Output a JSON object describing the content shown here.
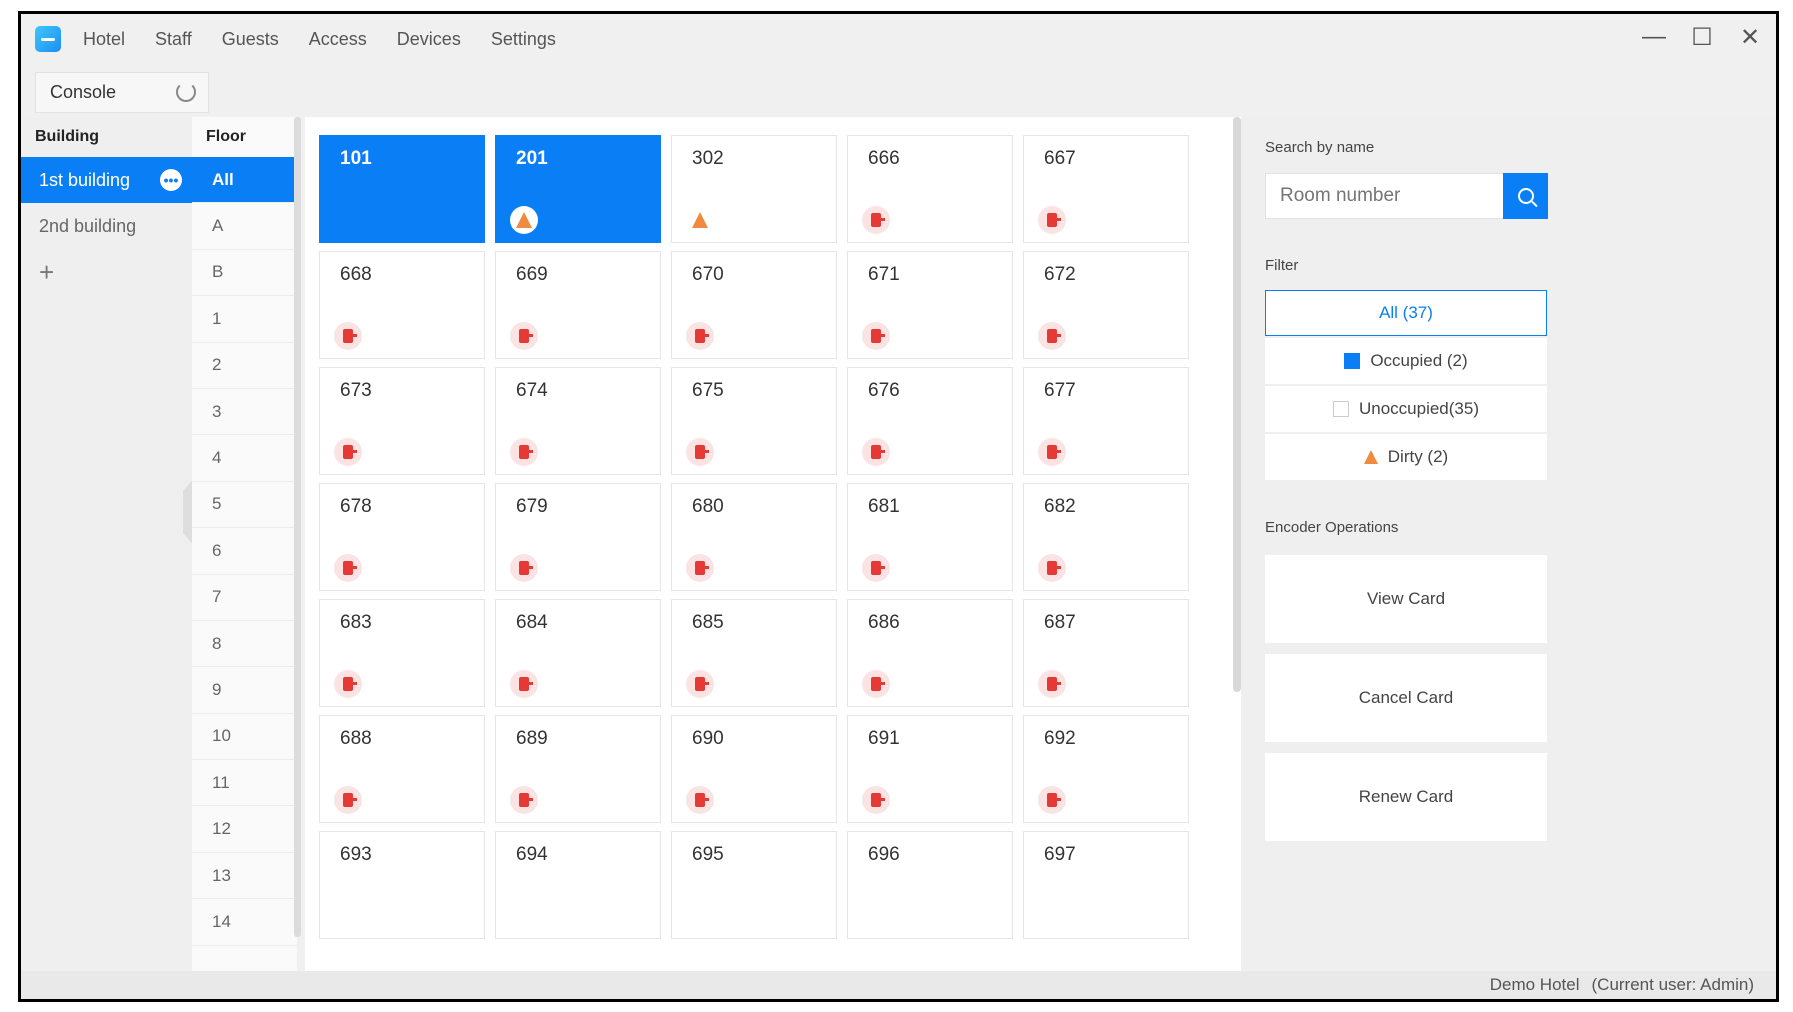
{
  "menu": [
    "Hotel",
    "Staff",
    "Guests",
    "Access",
    "Devices",
    "Settings"
  ],
  "window_controls": {
    "minimize": "—",
    "maximize": "☐",
    "close": "✕"
  },
  "tab": {
    "label": "Console"
  },
  "building": {
    "header": "Building",
    "items": [
      {
        "label": "1st building",
        "active": true
      },
      {
        "label": "2nd building",
        "active": false
      }
    ],
    "add_label": "+"
  },
  "floor": {
    "header": "Floor",
    "items": [
      "All",
      "A",
      "B",
      "1",
      "2",
      "3",
      "4",
      "5",
      "6",
      "7",
      "8",
      "9",
      "10",
      "11",
      "12",
      "13",
      "14"
    ]
  },
  "rooms": [
    {
      "number": "101",
      "status": "occupied",
      "icon": ""
    },
    {
      "number": "201",
      "status": "occupied",
      "icon": "dirty"
    },
    {
      "number": "302",
      "status": "unoccupied",
      "icon": "dirty"
    },
    {
      "number": "666",
      "status": "unoccupied",
      "icon": "lock"
    },
    {
      "number": "667",
      "status": "unoccupied",
      "icon": "lock"
    },
    {
      "number": "668",
      "status": "unoccupied",
      "icon": "lock"
    },
    {
      "number": "669",
      "status": "unoccupied",
      "icon": "lock"
    },
    {
      "number": "670",
      "status": "unoccupied",
      "icon": "lock"
    },
    {
      "number": "671",
      "status": "unoccupied",
      "icon": "lock"
    },
    {
      "number": "672",
      "status": "unoccupied",
      "icon": "lock"
    },
    {
      "number": "673",
      "status": "unoccupied",
      "icon": "lock"
    },
    {
      "number": "674",
      "status": "unoccupied",
      "icon": "lock"
    },
    {
      "number": "675",
      "status": "unoccupied",
      "icon": "lock"
    },
    {
      "number": "676",
      "status": "unoccupied",
      "icon": "lock"
    },
    {
      "number": "677",
      "status": "unoccupied",
      "icon": "lock"
    },
    {
      "number": "678",
      "status": "unoccupied",
      "icon": "lock"
    },
    {
      "number": "679",
      "status": "unoccupied",
      "icon": "lock"
    },
    {
      "number": "680",
      "status": "unoccupied",
      "icon": "lock"
    },
    {
      "number": "681",
      "status": "unoccupied",
      "icon": "lock"
    },
    {
      "number": "682",
      "status": "unoccupied",
      "icon": "lock"
    },
    {
      "number": "683",
      "status": "unoccupied",
      "icon": "lock"
    },
    {
      "number": "684",
      "status": "unoccupied",
      "icon": "lock"
    },
    {
      "number": "685",
      "status": "unoccupied",
      "icon": "lock"
    },
    {
      "number": "686",
      "status": "unoccupied",
      "icon": "lock"
    },
    {
      "number": "687",
      "status": "unoccupied",
      "icon": "lock"
    },
    {
      "number": "688",
      "status": "unoccupied",
      "icon": "lock"
    },
    {
      "number": "689",
      "status": "unoccupied",
      "icon": "lock"
    },
    {
      "number": "690",
      "status": "unoccupied",
      "icon": "lock"
    },
    {
      "number": "691",
      "status": "unoccupied",
      "icon": "lock"
    },
    {
      "number": "692",
      "status": "unoccupied",
      "icon": "lock"
    },
    {
      "number": "693",
      "status": "unoccupied",
      "icon": ""
    },
    {
      "number": "694",
      "status": "unoccupied",
      "icon": ""
    },
    {
      "number": "695",
      "status": "unoccupied",
      "icon": ""
    },
    {
      "number": "696",
      "status": "unoccupied",
      "icon": ""
    },
    {
      "number": "697",
      "status": "unoccupied",
      "icon": ""
    }
  ],
  "search": {
    "label": "Search by name",
    "placeholder": "Room number"
  },
  "filter": {
    "label": "Filter",
    "all": "All (37)",
    "occupied": "Occupied (2)",
    "unoccupied": "Unoccupied(35)",
    "dirty": "Dirty (2)"
  },
  "encoder": {
    "label": "Encoder Operations",
    "view": "View Card",
    "cancel": "Cancel Card",
    "renew": "Renew Card"
  },
  "status": {
    "hotel": "Demo Hotel",
    "user": "(Current user:  Admin)"
  },
  "colors": {
    "accent": "#0a7ff5",
    "lock": "#e53935",
    "dirty": "#f08a3e"
  }
}
